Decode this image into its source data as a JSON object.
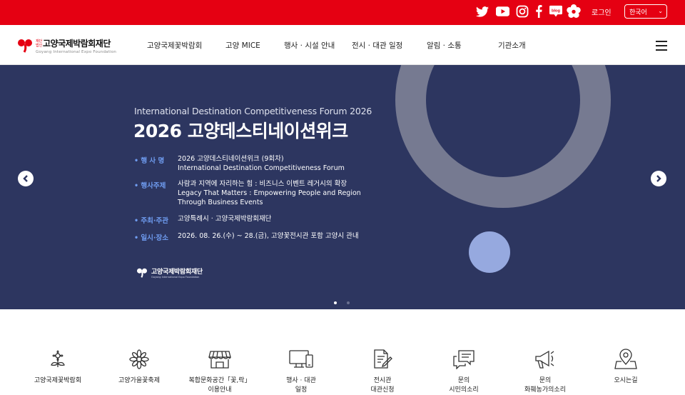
{
  "topbar": {
    "login_label": "로그인",
    "language_selected": "한국어",
    "sns_icons": [
      "twitter-icon",
      "youtube-icon",
      "instagram-icon",
      "facebook-icon",
      "blog-icon",
      "flower-sns-icon"
    ],
    "blog_label": "blog"
  },
  "header": {
    "logo_small": "재단법인",
    "logo_name": "고양국제박람회재단",
    "logo_sub": "Goyang International Expo Foundation",
    "nav": [
      "고양국제꽃박람회",
      "고양 MICE",
      "행사 · 시설 안내",
      "전시 · 대관 일정",
      "알림 · 소통",
      "기관소개"
    ]
  },
  "hero": {
    "subtitle": "International Destination Competitiveness Forum 2026",
    "title": "2026 고양데스티네이션위크",
    "info": [
      {
        "label": "• 행 사 명",
        "lines": [
          "2026 고양데스티네이션위크 (9회차)",
          "International Destination Competitiveness Forum"
        ]
      },
      {
        "label": "• 행사주제",
        "lines": [
          "사람과 지역에 자리하는 힘 : 비즈니스 이벤트 레거시의 확장",
          "Legacy That Matters : Empowering People and Region",
          "Through Business Events"
        ]
      },
      {
        "label": "• 주최·주관",
        "lines": [
          "고양특례시 · 고양국제박람회재단"
        ]
      },
      {
        "label": "• 일시·장소",
        "lines": [
          "2026. 08. 26.(수) ~ 28.(금), 고양꽃전시관 포함 고양시 관내"
        ]
      }
    ],
    "logo_name": "고양국제박람회재단",
    "logo_sub": "Goyang International Expo Foundation",
    "slide_count": 2,
    "active_slide": 1,
    "colors": {
      "background": "#2d3660",
      "ring": "#767a91",
      "dot": "#96a9df",
      "label": "#6f9cf0"
    }
  },
  "quick_menu": [
    {
      "icon": "flower-icon",
      "lines": [
        "고양국제꽃박람회"
      ]
    },
    {
      "icon": "autumn-flower-icon",
      "lines": [
        "고양가을꽃축제"
      ]
    },
    {
      "icon": "store-icon",
      "lines": [
        "복합문화공간「꽃,락」",
        "이용안내"
      ]
    },
    {
      "icon": "monitor-icon",
      "lines": [
        "행사 · 대관",
        "일정"
      ]
    },
    {
      "icon": "document-edit-icon",
      "lines": [
        "전시관",
        "대관신청"
      ]
    },
    {
      "icon": "chat-icon",
      "lines": [
        "문의",
        "시민의소리"
      ]
    },
    {
      "icon": "megaphone-icon",
      "lines": [
        "문의",
        "화훼농가의소리"
      ]
    },
    {
      "icon": "location-pin-icon",
      "lines": [
        "오시는길"
      ]
    }
  ],
  "brand": {
    "red": "#e50012"
  }
}
